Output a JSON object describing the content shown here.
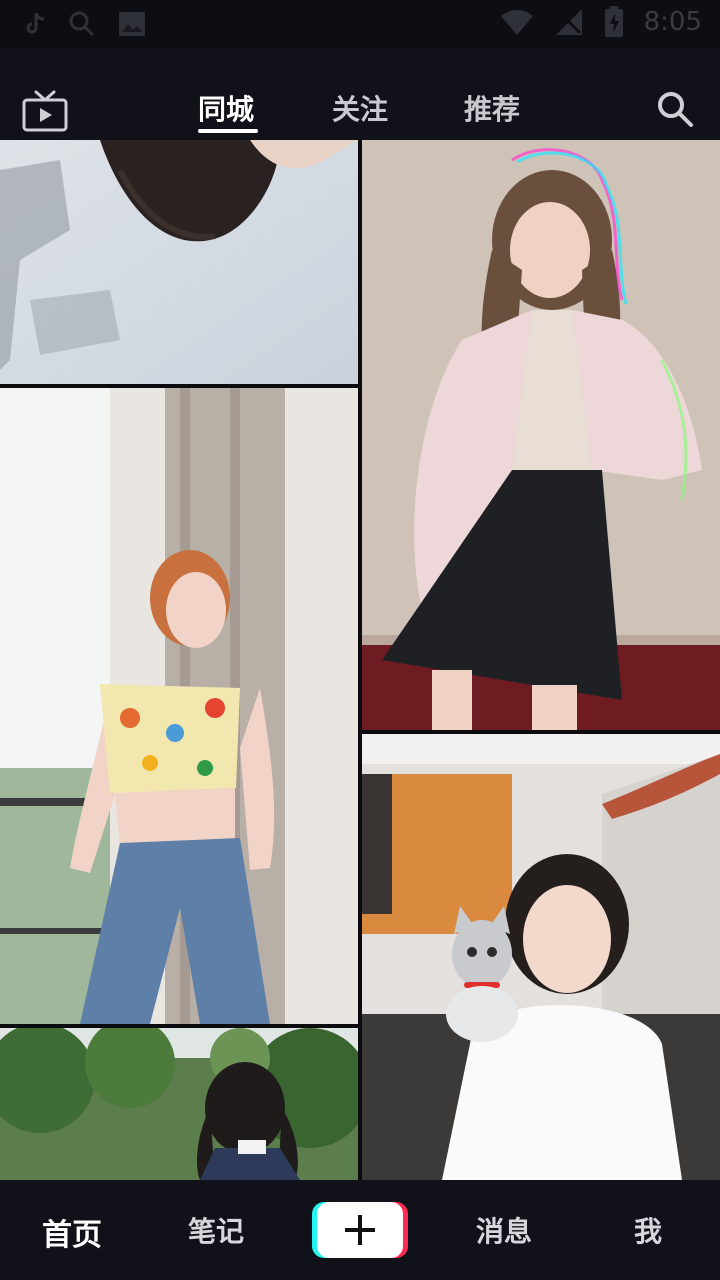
{
  "status_bar": {
    "time": "8:05"
  },
  "top_nav": {
    "tabs": [
      {
        "label": "同城",
        "active": true
      },
      {
        "label": "关注",
        "active": false
      },
      {
        "label": "推荐",
        "active": false
      }
    ]
  },
  "feed": {
    "videos": [
      {
        "id": "v1",
        "desc": "hair against sky"
      },
      {
        "id": "v2",
        "desc": "dancer in pink cardigan"
      },
      {
        "id": "v3",
        "desc": "woman in floral top and jeans"
      },
      {
        "id": "v4",
        "desc": "woman with cat sticker"
      },
      {
        "id": "v5",
        "desc": "girl with pigtails by trees"
      }
    ]
  },
  "bottom_nav": {
    "home": "首页",
    "notes": "笔记",
    "messages": "消息",
    "me": "我"
  },
  "colors": {
    "accent_cyan": "#25f4ee",
    "accent_red": "#fe2c55"
  }
}
